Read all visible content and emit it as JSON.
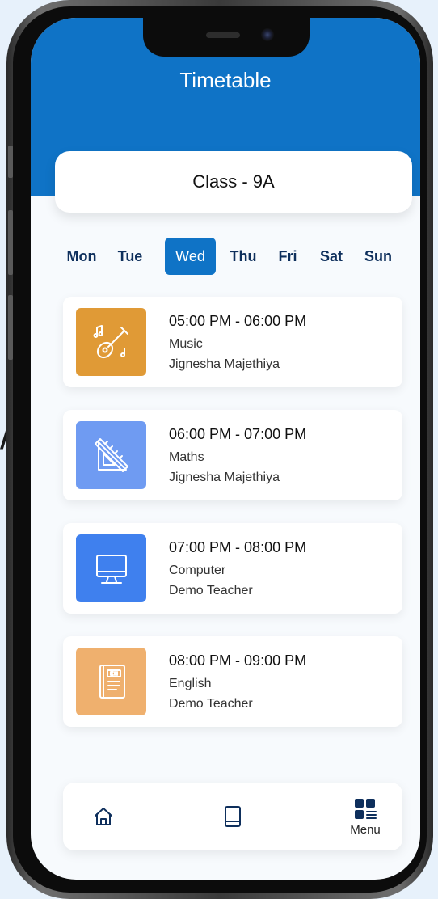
{
  "background_fragment": "/",
  "header": {
    "title": "Timetable"
  },
  "class_selector": {
    "label": "Class - 9A"
  },
  "days": [
    {
      "label": "Mon",
      "active": false
    },
    {
      "label": "Tue",
      "active": false
    },
    {
      "label": "Wed",
      "active": true
    },
    {
      "label": "Thu",
      "active": false
    },
    {
      "label": "Fri",
      "active": false
    },
    {
      "label": "Sat",
      "active": false
    },
    {
      "label": "Sun",
      "active": false
    }
  ],
  "lessons": [
    {
      "time": "05:00 PM - 06:00 PM",
      "subject": "Music",
      "teacher": "Jignesha Majethiya",
      "icon": "music-guitar-icon",
      "color": "#e09a36"
    },
    {
      "time": "06:00 PM - 07:00 PM",
      "subject": "Maths",
      "teacher": "Jignesha Majethiya",
      "icon": "ruler-triangle-icon",
      "color": "#6f9bf2"
    },
    {
      "time": "07:00 PM - 08:00 PM",
      "subject": "Computer",
      "teacher": "Demo Teacher",
      "icon": "monitor-icon",
      "color": "#3f80ee"
    },
    {
      "time": "08:00 PM - 09:00 PM",
      "subject": "English",
      "teacher": "Demo Teacher",
      "icon": "english-book-icon",
      "color": "#efb06e"
    }
  ],
  "bottom_nav": {
    "items": [
      {
        "icon": "home-icon",
        "label": ""
      },
      {
        "icon": "book-icon",
        "label": ""
      },
      {
        "icon": "menu-grid-icon",
        "label": "Menu"
      }
    ]
  },
  "colors": {
    "primary": "#0f73c6",
    "day_text": "#0e2f5c",
    "nav_icon": "#0e2f5c"
  }
}
